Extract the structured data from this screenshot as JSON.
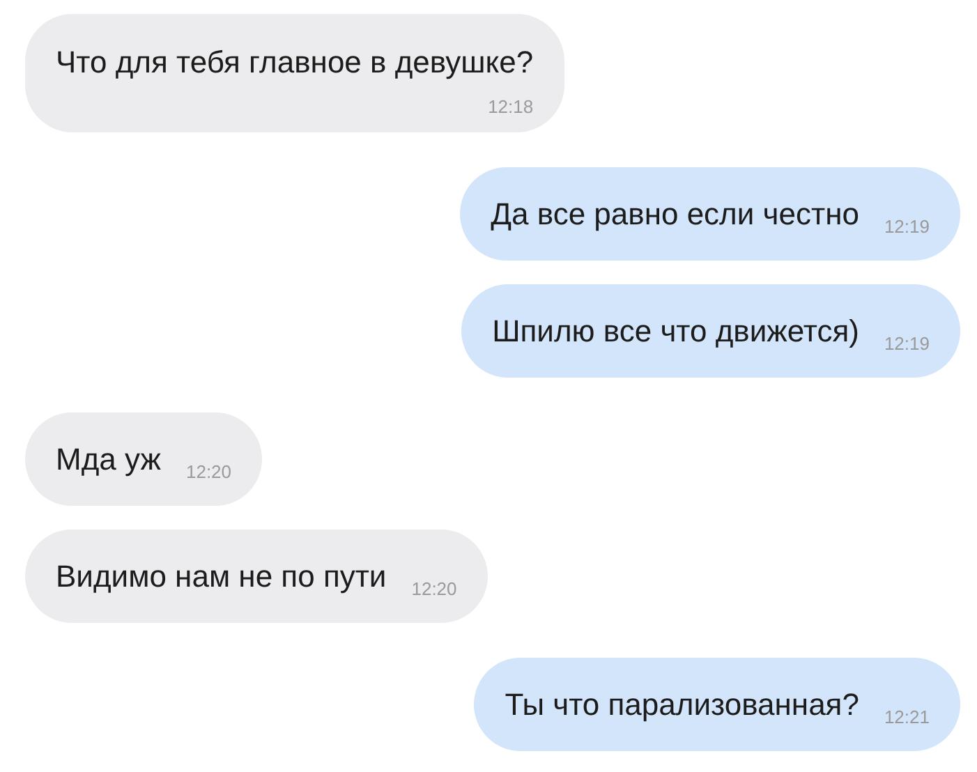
{
  "messages": [
    {
      "text": "Что для тебя главное в девушке?",
      "time": "12:18",
      "outgoing": false,
      "kind": "stacked"
    },
    {
      "text": "Да все равно если честно",
      "time": "12:19",
      "outgoing": true,
      "kind": "inline"
    },
    {
      "text": "Шпилю все что движется)",
      "time": "12:19",
      "outgoing": true,
      "kind": "inline"
    },
    {
      "text": "Мда уж",
      "time": "12:20",
      "outgoing": false,
      "kind": "inline"
    },
    {
      "text": "Видимо нам не по пути",
      "time": "12:20",
      "outgoing": false,
      "kind": "inline"
    },
    {
      "text": "Ты что парализованная?",
      "time": "12:21",
      "outgoing": true,
      "kind": "inline"
    }
  ]
}
